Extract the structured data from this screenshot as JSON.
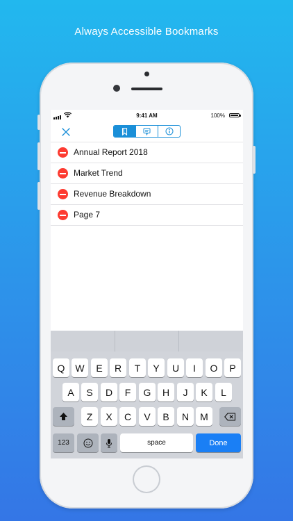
{
  "banner": "Always Accessible Bookmarks",
  "status": {
    "time": "9:41 AM",
    "battery": "100%"
  },
  "icons": {
    "close": "close-icon",
    "bookmark": "bookmark-icon",
    "comment": "comment-icon",
    "info": "info-icon",
    "delete": "delete-minus-icon",
    "shift": "shift-arrow-icon",
    "backspace": "backspace-icon",
    "emoji": "emoji-icon",
    "mic": "microphone-icon"
  },
  "colors": {
    "accent": "#1a8fd8",
    "delete": "#fd3b31",
    "done": "#1a7ff5"
  },
  "bookmarks": [
    {
      "label": "Annual Report 2018"
    },
    {
      "label": "Market Trend"
    },
    {
      "label": "Revenue Breakdown"
    },
    {
      "label": "Page 7"
    }
  ],
  "keyboard": {
    "row1": [
      "Q",
      "W",
      "E",
      "R",
      "T",
      "Y",
      "U",
      "I",
      "O",
      "P"
    ],
    "row2": [
      "A",
      "S",
      "D",
      "F",
      "G",
      "H",
      "J",
      "K",
      "L"
    ],
    "row3": [
      "Z",
      "X",
      "C",
      "V",
      "B",
      "N",
      "M"
    ],
    "numbers": "123",
    "space": "space",
    "done": "Done"
  }
}
